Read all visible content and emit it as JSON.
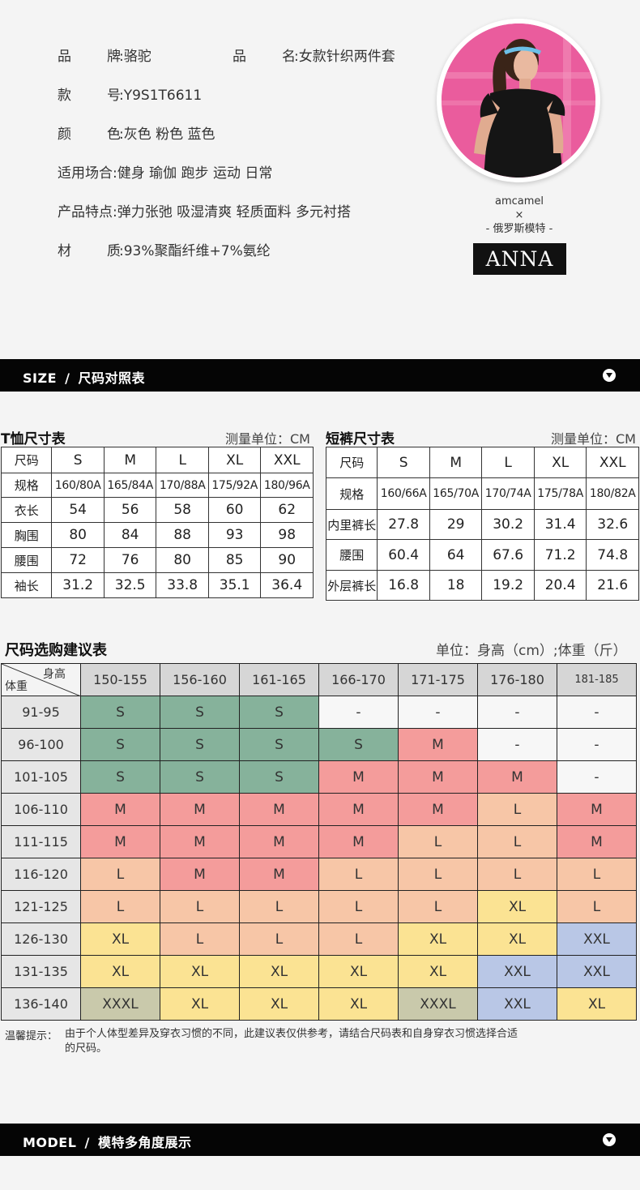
{
  "product": {
    "brand_label_1": "品",
    "brand_label_2": "牌",
    "brand_value": "骆驼",
    "name_label_1": "品",
    "name_label_2": "名",
    "name_value": "女款针织两件套",
    "model_label_1": "款",
    "model_label_2": "号",
    "model_value": "Y9S1T6611",
    "color_label_1": "颜",
    "color_label_2": "色",
    "color_value": "灰色 粉色 蓝色",
    "occasion_label": "适用场合",
    "occasion_value": "健身 瑜伽 跑步 运动 日常",
    "feature_label": "产品特点",
    "feature_value": "弹力张弛 吸湿清爽 轻质面料 多元衬搭",
    "material_label_1": "材",
    "material_label_2": "质",
    "material_value": "93%聚酯纤维+7%氨纶",
    "colon": ":"
  },
  "model": {
    "brand": "amcamel",
    "cross": "×",
    "origin": "- 俄罗斯模特 -",
    "name": "ANNA"
  },
  "size_bar": {
    "en": "SIZE",
    "slash": "/",
    "cn": "尺码对照表"
  },
  "model_bar": {
    "en": "MODEL",
    "slash": "/",
    "cn": "模特多角度展示"
  },
  "tshirt": {
    "title": "T恤尺寸表",
    "unit": "测量单位：CM",
    "header": [
      "尺码",
      "S",
      "M",
      "L",
      "XL",
      "XXL"
    ],
    "rows": [
      [
        "规格",
        "160/80A",
        "165/84A",
        "170/88A",
        "175/92A",
        "180/96A"
      ],
      [
        "衣长",
        "54",
        "56",
        "58",
        "60",
        "62"
      ],
      [
        "胸围",
        "80",
        "84",
        "88",
        "93",
        "98"
      ],
      [
        "腰围",
        "72",
        "76",
        "80",
        "85",
        "90"
      ],
      [
        "袖长",
        "31.2",
        "32.5",
        "33.8",
        "35.1",
        "36.4"
      ]
    ]
  },
  "shorts": {
    "title": "短裤尺寸表",
    "unit": "测量单位：CM",
    "header": [
      "尺码",
      "S",
      "M",
      "L",
      "XL",
      "XXL"
    ],
    "rows": [
      [
        "规格",
        "160/66A",
        "165/70A",
        "170/74A",
        "175/78A",
        "180/82A"
      ],
      [
        "内里裤长",
        "27.8",
        "29",
        "30.2",
        "31.4",
        "32.6"
      ],
      [
        "腰围",
        "60.4",
        "64",
        "67.6",
        "71.2",
        "74.8"
      ],
      [
        "外层裤长",
        "16.8",
        "18",
        "19.2",
        "20.4",
        "21.6"
      ]
    ]
  },
  "recommend": {
    "title": "尺码选购建议表",
    "unit": "单位：身高（cm）;体重（斤）",
    "corner_height": "身高",
    "corner_weight": "体重",
    "heights": [
      "150-155",
      "156-160",
      "161-165",
      "166-170",
      "171-175",
      "176-180",
      "181-185"
    ],
    "rows": [
      {
        "weight": "91-95",
        "sizes": [
          "S",
          "S",
          "S",
          "-",
          "-",
          "-",
          "-"
        ]
      },
      {
        "weight": "96-100",
        "sizes": [
          "S",
          "S",
          "S",
          "S",
          "M",
          "-",
          "-"
        ]
      },
      {
        "weight": "101-105",
        "sizes": [
          "S",
          "S",
          "S",
          "M",
          "M",
          "M",
          "-"
        ]
      },
      {
        "weight": "106-110",
        "sizes": [
          "M",
          "M",
          "M",
          "M",
          "M",
          "L",
          "M"
        ]
      },
      {
        "weight": "111-115",
        "sizes": [
          "M",
          "M",
          "M",
          "M",
          "L",
          "L",
          "M"
        ]
      },
      {
        "weight": "116-120",
        "sizes": [
          "L",
          "M",
          "M",
          "L",
          "L",
          "L",
          "L"
        ]
      },
      {
        "weight": "121-125",
        "sizes": [
          "L",
          "L",
          "L",
          "L",
          "L",
          "XL",
          "L"
        ]
      },
      {
        "weight": "126-130",
        "sizes": [
          "XL",
          "L",
          "L",
          "L",
          "XL",
          "XL",
          "XXL"
        ]
      },
      {
        "weight": "131-135",
        "sizes": [
          "XL",
          "XL",
          "XL",
          "XL",
          "XL",
          "XXL",
          "XXL"
        ]
      },
      {
        "weight": "136-140",
        "sizes": [
          "XXXL",
          "XL",
          "XL",
          "XL",
          "XXXL",
          "XXL",
          "XL"
        ]
      }
    ],
    "colors": {
      "S": "#86b29b",
      "M": "#f49c9b",
      "L": "#f7c6a7",
      "XL": "#fbe393",
      "XXL": "#b9c7e6",
      "XXXL": "#c9c9ab",
      "-": "#f7f7f7"
    }
  },
  "note": {
    "label": "温馨提示：",
    "text": "由于个人体型差异及穿衣习惯的不同，此建议表仅供参考，请结合尺码表和自身穿衣习惯选择合适的尺码。"
  }
}
